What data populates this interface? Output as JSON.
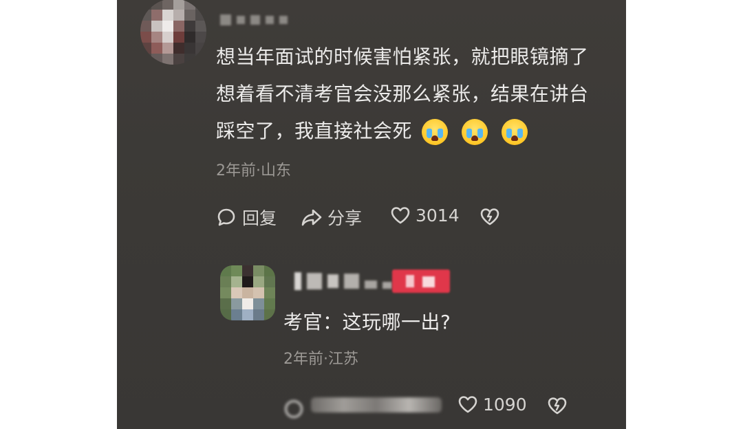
{
  "comment1": {
    "avatar_colors": [
      "#4b4644",
      "#5a5350",
      "#6e6562",
      "#a59f9c",
      "#7a7372",
      "#545050",
      "#5e5856",
      "#8e6d6b",
      "#d9d4d2",
      "#b7aeac",
      "#6a6361",
      "#4f4b4a",
      "#6f5a58",
      "#c9c2c0",
      "#efebea",
      "#8a6664",
      "#3e3a3a",
      "#5b5756",
      "#7b4d4a",
      "#a68582",
      "#d7cfcd",
      "#6e3d3b",
      "#2f2b2b",
      "#4c4848",
      "#5e4341",
      "#8e5c59",
      "#b49996",
      "#3f2d2c",
      "#393535",
      "#474343",
      "#4d4745",
      "#655b5a",
      "#7e7371",
      "#4a4140",
      "#3e3b3a",
      "#434040"
    ],
    "lines": [
      "想当年面试的时候害怕紧张，就把眼镜摘了",
      "想着看不清考官会没那么紧张，结果在讲台",
      "踩空了，我直接社会死"
    ],
    "meta": "2年前·山东",
    "reply_label": "回复",
    "share_label": "分享",
    "like_count": "3014"
  },
  "comment2": {
    "avatar_colors": [
      "#5f7a4c",
      "#6f8a58",
      "#3b3030",
      "#7a8d64",
      "#5c7448",
      "#6a7f55",
      "#a5b38f",
      "#1f1a1a",
      "#9aa882",
      "#617650",
      "#758a5e",
      "#d9c8b8",
      "#c9b4a0",
      "#d4c2b0",
      "#6e8458",
      "#5a6e4a",
      "#8a9a9f",
      "#f0ece8",
      "#7e8f98",
      "#627a4e",
      "#566b47",
      "#6b7f90",
      "#9fb0c4",
      "#6a7b8a",
      "#5d7249"
    ],
    "text": "考官：这玩哪一出?",
    "meta": "2年前·江苏",
    "like_count": "1090"
  },
  "colors": {
    "panel_bg": "#3c3a37",
    "text_main": "#ecebea",
    "text_meta": "#9c9995",
    "action": "#d6d4d1",
    "badge": "#e0374a"
  }
}
